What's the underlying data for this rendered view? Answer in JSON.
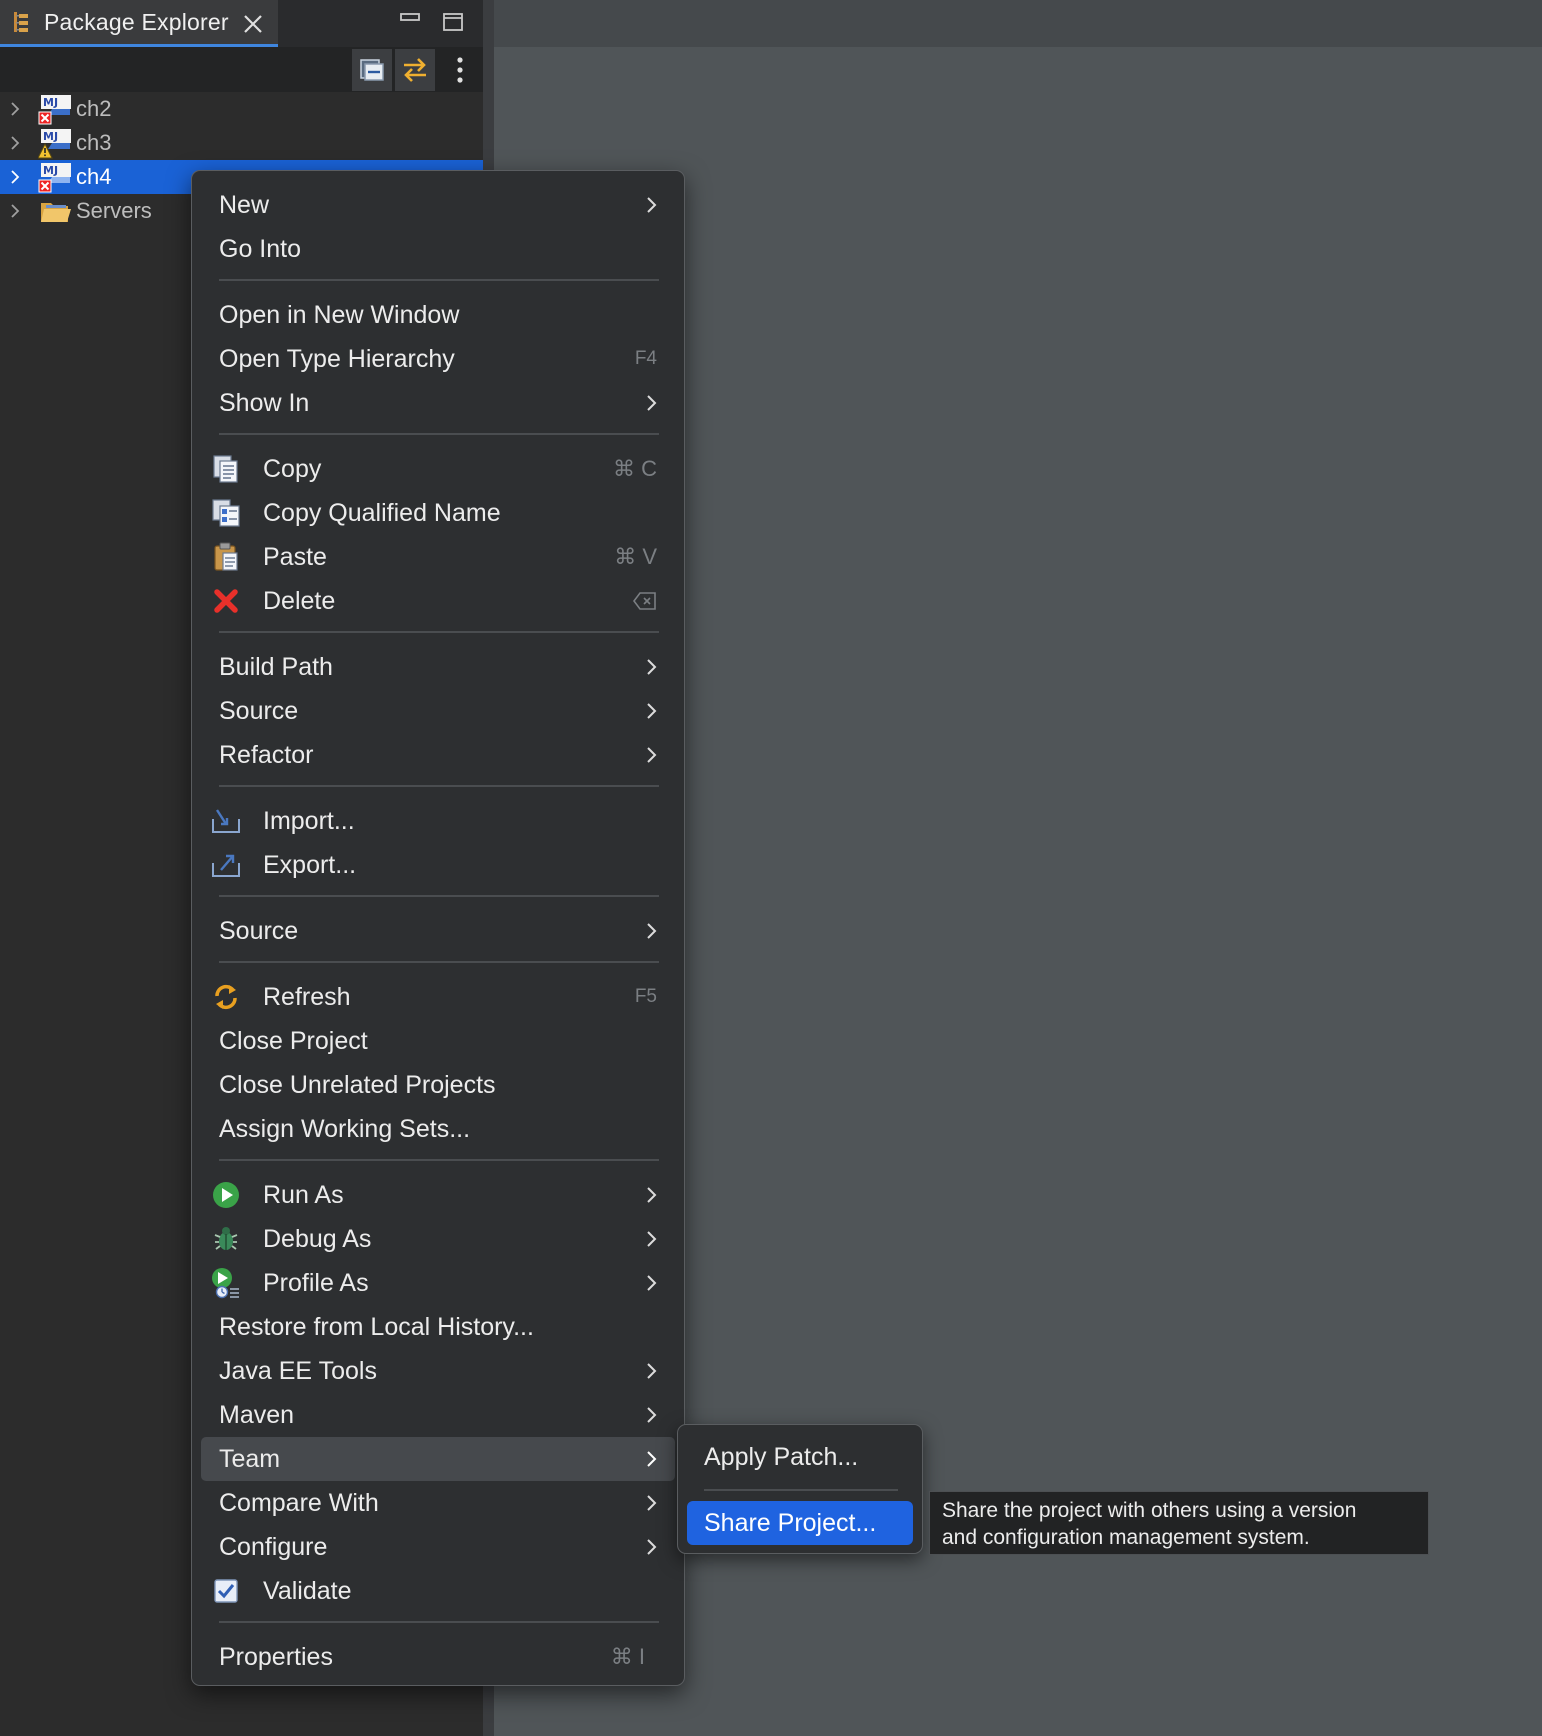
{
  "panel": {
    "tab_label": "Package Explorer",
    "close_icon": "close-icon",
    "minimize_icon": "minimize-icon",
    "maximize_icon": "maximize-icon"
  },
  "toolbar": {
    "collapse_all_icon": "collapse-all-icon",
    "link_with_editor_icon": "link-with-editor-icon",
    "view_menu_icon": "kebab-menu-icon"
  },
  "tree": {
    "items": [
      {
        "label": "ch2",
        "icon": "maven-java-project-error-icon",
        "selected": false
      },
      {
        "label": "ch3",
        "icon": "maven-java-project-warning-icon",
        "selected": false
      },
      {
        "label": "ch4",
        "icon": "maven-java-project-error-icon",
        "selected": true
      },
      {
        "label": "Servers",
        "icon": "folder-icon",
        "selected": false
      }
    ]
  },
  "context_menu": {
    "new": "New",
    "go_into": "Go Into",
    "open_in_new_window": "Open in New Window",
    "open_type_hierarchy": "Open Type Hierarchy",
    "open_type_hierarchy_shortcut": "F4",
    "show_in": "Show In",
    "copy": "Copy",
    "copy_shortcut": "⌘ C",
    "copy_qualified_name": "Copy Qualified Name",
    "paste": "Paste",
    "paste_shortcut": "⌘ V",
    "delete": "Delete",
    "build_path": "Build Path",
    "source_1": "Source",
    "refactor": "Refactor",
    "import": "Import...",
    "export": "Export...",
    "source_2": "Source",
    "refresh": "Refresh",
    "refresh_shortcut": "F5",
    "close_project": "Close Project",
    "close_unrelated_projects": "Close Unrelated Projects",
    "assign_working_sets": "Assign Working Sets...",
    "run_as": "Run As",
    "debug_as": "Debug As",
    "profile_as": "Profile As",
    "restore_from_local_history": "Restore from Local History...",
    "java_ee_tools": "Java EE Tools",
    "maven": "Maven",
    "team": "Team",
    "compare_with": "Compare With",
    "configure": "Configure",
    "validate": "Validate",
    "properties": "Properties",
    "properties_shortcut": "⌘ I",
    "highlighted_item": "Team"
  },
  "team_submenu": {
    "apply_patch": "Apply Patch...",
    "share_project": "Share Project...",
    "selected_item": "Share Project..."
  },
  "tooltip": {
    "line1": "Share the project with others using a version",
    "line2": "and configuration management system."
  },
  "colors": {
    "selection_blue": "#1a62d6",
    "menu_background": "#2d2f31",
    "editor_background": "#505558"
  }
}
